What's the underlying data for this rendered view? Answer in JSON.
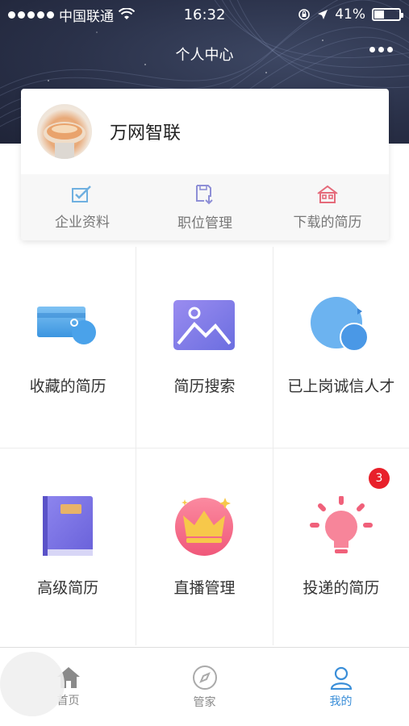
{
  "status_bar": {
    "carrier": "中国联通",
    "time": "16:32",
    "battery": "41%",
    "battery_level": 0.41
  },
  "navbar": {
    "title": "个人中心",
    "more_icon": "more-dots-icon"
  },
  "profile": {
    "company_name": "万网智联",
    "actions": [
      {
        "label": "企业资料",
        "icon": "checkbox-edit-icon",
        "color": "#6fb0e0"
      },
      {
        "label": "职位管理",
        "icon": "save-document-icon",
        "color": "#8e8fd6"
      },
      {
        "label": "下载的简历",
        "icon": "house-icon",
        "color": "#e56a7a"
      }
    ]
  },
  "grid": [
    {
      "label": "收藏的简历",
      "icon": "card-wallet-icon"
    },
    {
      "label": "简历搜索",
      "icon": "image-landscape-icon"
    },
    {
      "label": "已上岗诚信人才",
      "icon": "refresh-circle-icon"
    },
    {
      "label": "高级简历",
      "icon": "book-icon"
    },
    {
      "label": "直播管理",
      "icon": "crown-icon"
    },
    {
      "label": "投递的简历",
      "icon": "lightbulb-icon",
      "badge": "3"
    }
  ],
  "tabbar": {
    "items": [
      {
        "label": "首页",
        "icon": "home-icon",
        "active": false
      },
      {
        "label": "管家",
        "icon": "compass-icon",
        "active": false
      },
      {
        "label": "我的",
        "icon": "person-icon",
        "active": true
      }
    ]
  },
  "colors": {
    "accent": "#3a8ed8",
    "badge": "#e8202a",
    "header_bg": "#2a3149"
  }
}
